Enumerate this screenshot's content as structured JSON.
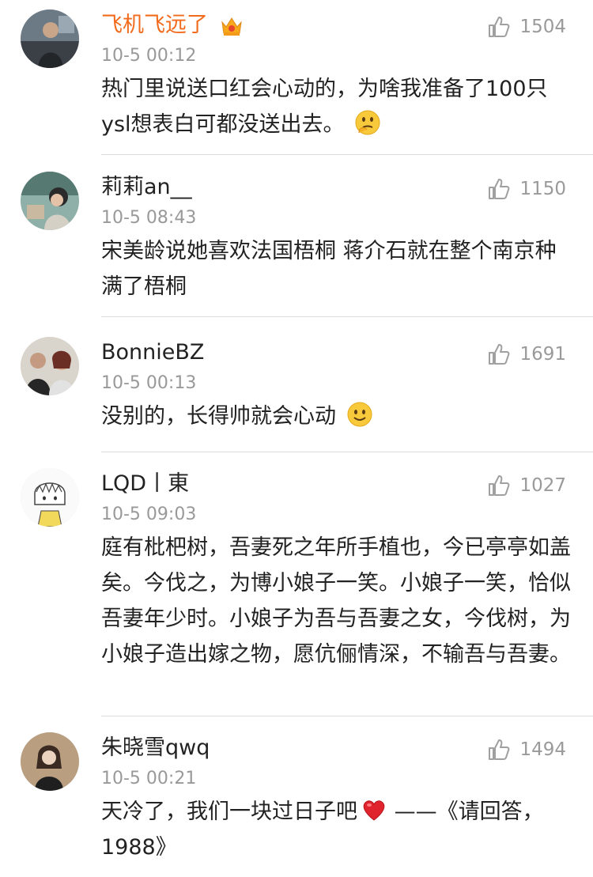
{
  "comments": [
    {
      "username": "飞机飞远了",
      "time": "10-5 00:12",
      "likes": "1504",
      "text": "热门里说送口红会心动的，为啥我准备了100只ysl想表白可都没送出去。",
      "emoji": "thinking-face",
      "vip_color": "#f26b1d",
      "badge": "crown-icon"
    },
    {
      "username": "莉莉an__",
      "time": "10-5 08:43",
      "likes": "1150",
      "text": "宋美龄说她喜欢法国梧桐  蒋介石就在整个南京种满了梧桐"
    },
    {
      "username": "BonnieBZ",
      "time": "10-5 00:13",
      "likes": "1691",
      "text": "没别的，长得帅就会心动",
      "emoji": "smile-face"
    },
    {
      "username": "LQD丨東",
      "time": "10-5 09:03",
      "likes": "1027",
      "text": "庭有枇杷树，吾妻死之年所手植也，今已亭亭如盖矣。今伐之，为博小娘子一笑。小娘子一笑，恰似吾妻年少时。小娘子为吾与吾妻之女，今伐树，为小娘子造出嫁之物，愿伉俪情深，不输吾与吾妻。"
    },
    {
      "username": "朱晓雪qwq",
      "time": "10-5 00:21",
      "likes": "1494",
      "text_before": "天冷了，我们一块过日子吧",
      "emoji": "red-heart",
      "text_after": " ——《请回答，1988》"
    }
  ]
}
